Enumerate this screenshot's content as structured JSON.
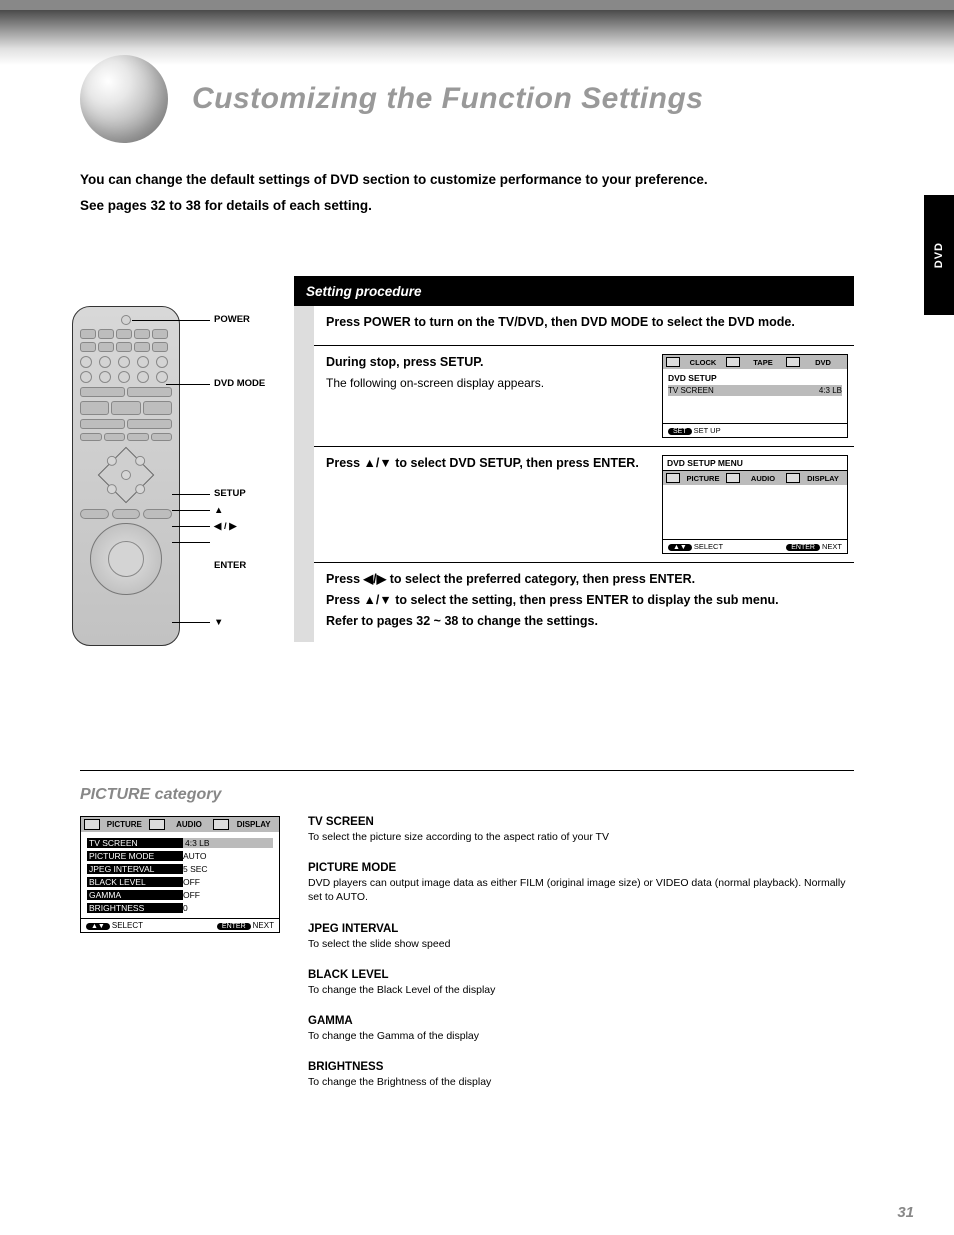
{
  "page_number": "31",
  "side_tab": "DVD",
  "title": "Customizing the Function Settings",
  "intro": {
    "p1": "You can change the default settings of DVD section to customize performance to your preference.",
    "p2": "See pages 32 to 38 for details of each setting."
  },
  "black_bar": "Setting procedure",
  "remote_labels": {
    "power": "POWER",
    "dvd_mode": "DVD MODE",
    "setup": "SETUP",
    "up": "▲",
    "left_right": "◀ / ▶",
    "enter": "ENTER",
    "down": "▼"
  },
  "steps": {
    "s1": "Press POWER to turn on the TV/DVD, then DVD MODE to select the DVD mode.",
    "s2": {
      "h": "During stop, press SETUP.",
      "p": "The following on-screen display appears.",
      "screen": {
        "tabs": [
          "CLOCK",
          "TAPE",
          "DVD"
        ],
        "block_label": "DVD SETUP",
        "row": {
          "k": "TV SCREEN",
          "v": "4:3 LB"
        },
        "foot_left_pill": "SET",
        "foot_left_txt": "SET UP",
        "foot_right": ""
      }
    },
    "s3": {
      "h": "Press ▲/▼ to select DVD SETUP, then press ENTER.",
      "screen": {
        "title": "DVD SETUP MENU",
        "tabs": [
          "PICTURE",
          "AUDIO",
          "DISPLAY"
        ],
        "foot_left_pill": "▲▼",
        "foot_left_txt": "SELECT",
        "foot_right_pill": "ENTER",
        "foot_right_txt": "NEXT"
      }
    },
    "s4": {
      "h1": "Press ◀/▶ to select the preferred category, then press ENTER.",
      "h2": "Press ▲/▼ to select the setting, then press ENTER to display the sub menu.",
      "h3": "Refer to pages 32 ~ 38 to change the settings."
    }
  },
  "lower_title": "PICTURE category",
  "osd": {
    "tabs": [
      "PICTURE",
      "AUDIO",
      "DISPLAY"
    ],
    "rows": [
      {
        "k": "TV SCREEN",
        "v": "4:3 LB",
        "hi": true,
        "first": true
      },
      {
        "k": "PICTURE MODE",
        "v": "AUTO",
        "hi": true
      },
      {
        "k": "JPEG INTERVAL",
        "v": "5 SEC",
        "hi": true
      },
      {
        "k": "BLACK LEVEL",
        "v": "OFF",
        "hi": true
      },
      {
        "k": "GAMMA",
        "v": "OFF",
        "hi": true
      },
      {
        "k": "BRIGHTNESS",
        "v": "0",
        "hi": true
      }
    ],
    "foot_left_pill": "▲▼",
    "foot_left_txt": "SELECT",
    "foot_right_pill": "ENTER",
    "foot_right_txt": "NEXT"
  },
  "descs": [
    {
      "h": "TV SCREEN",
      "t": "To select the picture size according to the aspect ratio of your TV"
    },
    {
      "h": "PICTURE MODE",
      "t": "DVD players can output image data as either FILM (original image size) or VIDEO data (normal playback). Normally set to AUTO."
    },
    {
      "h": "JPEG INTERVAL",
      "t": "To select the slide show speed"
    },
    {
      "h": "BLACK LEVEL",
      "t": "To change the Black Level of the display"
    },
    {
      "h": "GAMMA",
      "t": "To change the Gamma of the display"
    },
    {
      "h": "BRIGHTNESS",
      "t": "To change the Brightness of the display"
    }
  ]
}
